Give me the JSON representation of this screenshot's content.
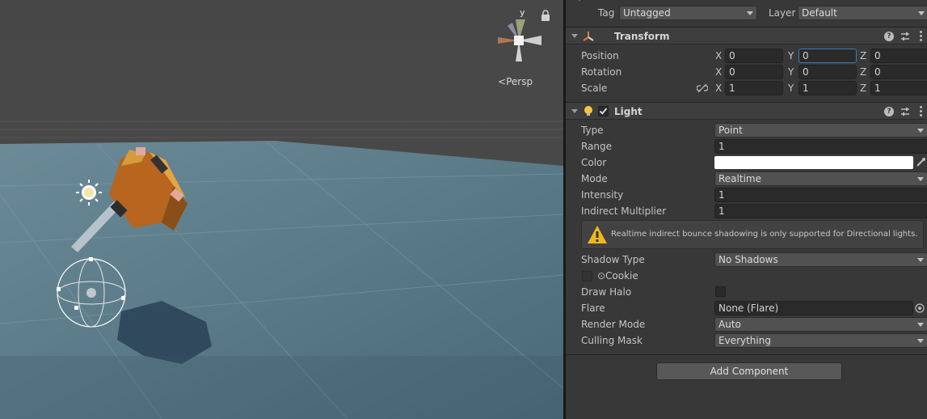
{
  "scene": {
    "gizmo_axis_label": "y",
    "view_mode": "Persp"
  },
  "top": {
    "tag_label": "Tag",
    "tag_value": "Untagged",
    "layer_label": "Layer",
    "layer_value": "Default"
  },
  "transform": {
    "title": "Transform",
    "position_label": "Position",
    "rotation_label": "Rotation",
    "scale_label": "Scale",
    "axis_x": "X",
    "axis_y": "Y",
    "axis_z": "Z",
    "position": {
      "x": "0",
      "y": "0",
      "z": "0"
    },
    "rotation": {
      "x": "0",
      "y": "0",
      "z": "0"
    },
    "scale": {
      "x": "1",
      "y": "1",
      "z": "1"
    }
  },
  "light": {
    "title": "Light",
    "type_label": "Type",
    "type_value": "Point",
    "range_label": "Range",
    "range_value": "1",
    "color_label": "Color",
    "color_value": "#ffffff",
    "mode_label": "Mode",
    "mode_value": "Realtime",
    "intensity_label": "Intensity",
    "intensity_value": "1",
    "indirect_label": "Indirect Multiplier",
    "indirect_value": "1",
    "warning_text": "Realtime indirect bounce shadowing is only supported for Directional lights.",
    "shadow_label": "Shadow Type",
    "shadow_value": "No Shadows",
    "cookie_label": "Cookie",
    "halo_label": "Draw Halo",
    "flare_label": "Flare",
    "flare_value": "None (Flare)",
    "render_mode_label": "Render Mode",
    "render_mode_value": "Auto",
    "culling_label": "Culling Mask",
    "culling_value": "Everything"
  },
  "add_component_label": "Add Component",
  "colors": {
    "accent_focus": "#3a79bb",
    "warning_yellow": "#f0b71e",
    "light_bulb": "#f5c542"
  }
}
